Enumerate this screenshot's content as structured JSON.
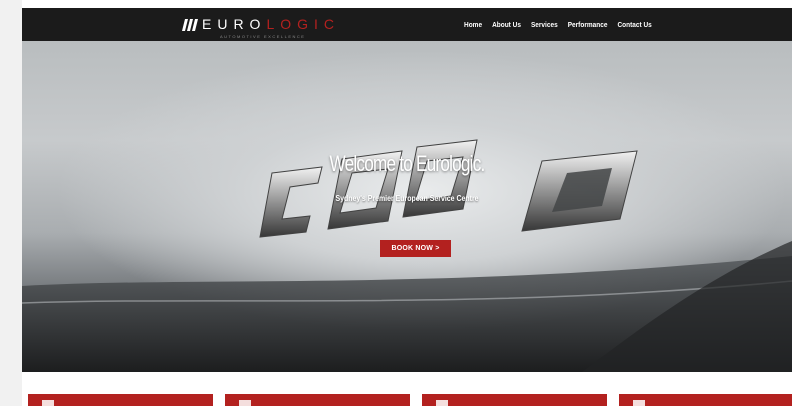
{
  "header": {
    "logo": {
      "text_main": "EURO",
      "text_accent": "LOGIC",
      "tagline": "AUTOMOTIVE EXCELLENCE"
    },
    "nav": [
      {
        "label": "Home"
      },
      {
        "label": "About Us"
      },
      {
        "label": "Services"
      },
      {
        "label": "Performance"
      },
      {
        "label": "Contact Us"
      }
    ]
  },
  "hero": {
    "title": "Welcome to Eurologic.",
    "subtitle": "Sydney's Premier European Service Centre",
    "button_label": "BOOK NOW >"
  },
  "cards": [
    {
      "icon": "service-icon"
    },
    {
      "icon": "service-icon"
    },
    {
      "icon": "service-icon"
    },
    {
      "icon": "service-icon"
    }
  ],
  "colors": {
    "accent": "#b3211f",
    "header_bg": "#1b1b1b",
    "page_bg": "#f1f1f1"
  }
}
